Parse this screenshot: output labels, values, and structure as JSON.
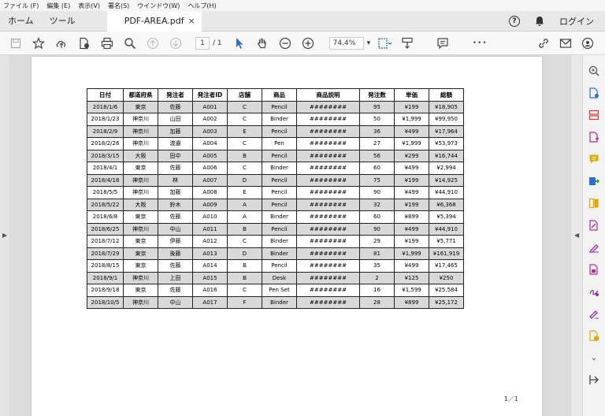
{
  "menu": [
    "ファイル (F)",
    "編集 (E)",
    "表示(V)",
    "署名(S)",
    "ウインドウ(W)",
    "ヘルプ(H)"
  ],
  "tabs": {
    "home": "ホーム",
    "tools": "ツール",
    "document": "PDF-AREA.pdf",
    "close": "×"
  },
  "header_right": {
    "help": "?",
    "login": "ログイン"
  },
  "toolbar": {
    "page_current": "1",
    "page_sep": "/",
    "page_total": "1",
    "zoom": "74.4%",
    "zoom_arrow": "▾",
    "more": "•••"
  },
  "table": {
    "headers": [
      "日付",
      "都道府県",
      "発注者",
      "発注者ID",
      "店舗",
      "商品",
      "商品説明",
      "発注数",
      "単価",
      "総額"
    ],
    "rows": [
      [
        "2018/1/6",
        "東京",
        "佐藤",
        "A001",
        "C",
        "Pencil",
        "########",
        "95",
        "¥199",
        "¥18,905"
      ],
      [
        "2018/1/23",
        "神奈川",
        "山田",
        "A002",
        "C",
        "Binder",
        "########",
        "50",
        "¥1,999",
        "¥99,950"
      ],
      [
        "2018/2/9",
        "神奈川",
        "加藤",
        "A003",
        "E",
        "Pencil",
        "########",
        "36",
        "¥499",
        "¥17,964"
      ],
      [
        "2018/2/26",
        "神奈川",
        "渡邉",
        "A004",
        "C",
        "Pen",
        "########",
        "27",
        "¥1,999",
        "¥53,973"
      ],
      [
        "2018/3/15",
        "大阪",
        "田中",
        "A005",
        "B",
        "Pencil",
        "########",
        "56",
        "¥299",
        "¥16,744"
      ],
      [
        "2018/4/1",
        "東京",
        "佐藤",
        "A006",
        "C",
        "Binder",
        "########",
        "60",
        "¥499",
        "¥2,994"
      ],
      [
        "2018/4/18",
        "神奈川",
        "林",
        "A007",
        "D",
        "Pencil",
        "########",
        "75",
        "¥199",
        "¥14,925"
      ],
      [
        "2018/5/5",
        "神奈川",
        "加藤",
        "A008",
        "E",
        "Pencil",
        "########",
        "90",
        "¥499",
        "¥44,910"
      ],
      [
        "2018/5/22",
        "大阪",
        "鈴木",
        "A009",
        "A",
        "Pencil",
        "########",
        "32",
        "¥199",
        "¥6,368"
      ],
      [
        "2018/6/8",
        "東京",
        "佐藤",
        "A010",
        "A",
        "Binder",
        "########",
        "60",
        "¥899",
        "¥5,394"
      ],
      [
        "2018/6/25",
        "神奈川",
        "中山",
        "A011",
        "B",
        "Pencil",
        "########",
        "90",
        "¥499",
        "¥44,910"
      ],
      [
        "2018/7/12",
        "東京",
        "伊藤",
        "A012",
        "C",
        "Binder",
        "########",
        "29",
        "¥199",
        "¥5,771"
      ],
      [
        "2018/7/29",
        "東京",
        "後藤",
        "A013",
        "D",
        "Binder",
        "########",
        "81",
        "¥1,999",
        "¥161,919"
      ],
      [
        "2018/8/15",
        "東京",
        "佐藤",
        "A014",
        "B",
        "Pencil",
        "########",
        "35",
        "¥499",
        "¥17,465"
      ],
      [
        "2018/9/1",
        "神奈川",
        "上田",
        "A015",
        "B",
        "Desk",
        "########",
        "2",
        "¥125",
        "¥250"
      ],
      [
        "2018/9/18",
        "東京",
        "佐藤",
        "A016",
        "C",
        "Pen Set",
        "########",
        "16",
        "¥1,599",
        "¥25,584"
      ],
      [
        "2018/10/5",
        "神奈川",
        "中山",
        "A017",
        "F",
        "Binder",
        "########",
        "28",
        "¥899",
        "¥25,172"
      ]
    ]
  },
  "page_footer": "1／1",
  "colors": {
    "accent_blue": "#2d6fd6",
    "tool_purple": "#9b2fae",
    "tool_red": "#d63b3b",
    "tool_green": "#2e8b3a",
    "tool_yellow": "#e0a800"
  }
}
